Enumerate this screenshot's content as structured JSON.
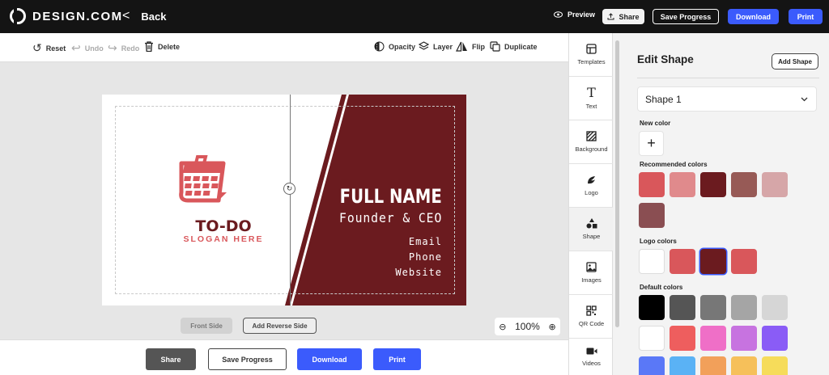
{
  "topbar": {
    "brand": "DESIGN.COM",
    "back_label": "Back",
    "preview_label": "Preview",
    "share_label": "Share",
    "save_label": "Save Progress",
    "download_label": "Download",
    "print_label": "Print"
  },
  "toolbar": {
    "reset": "Reset",
    "undo": "Undo",
    "redo": "Redo",
    "delete": "Delete",
    "opacity": "Opacity",
    "layer": "Layer",
    "flip": "Flip",
    "duplicate": "Duplicate"
  },
  "card": {
    "logo_title": "TO-DO",
    "slogan": "SLOGAN HERE",
    "full_name": "FULL NAME",
    "role": "Founder & CEO",
    "email": "Email",
    "phone": "Phone",
    "website": "Website",
    "colors": {
      "dark_red": "#6b1b1f",
      "logo_red": "#d9575b"
    }
  },
  "canvas": {
    "front_side": "Front Side",
    "add_reverse": "Add Reverse Side",
    "zoom": "100%"
  },
  "bottombar": {
    "share": "Share",
    "save": "Save Progress",
    "download": "Download",
    "print": "Print"
  },
  "sidenav": {
    "items": [
      {
        "label": "Templates",
        "icon": "templates-icon"
      },
      {
        "label": "Text",
        "icon": "text-icon"
      },
      {
        "label": "Background",
        "icon": "background-icon"
      },
      {
        "label": "Logo",
        "icon": "logo-icon"
      },
      {
        "label": "Shape",
        "icon": "shape-icon"
      },
      {
        "label": "Images",
        "icon": "images-icon"
      },
      {
        "label": "QR Code",
        "icon": "qr-code-icon"
      },
      {
        "label": "Videos",
        "icon": "videos-icon"
      }
    ]
  },
  "panel": {
    "title": "Edit Shape",
    "add_shape": "Add Shape",
    "selected_shape": "Shape 1",
    "new_color_label": "New color",
    "recommended_label": "Recommended colors",
    "logo_colors_label": "Logo colors",
    "default_colors_label": "Default colors",
    "recommended_colors": [
      "#d9575b",
      "#e08a8c",
      "#6b1b1f",
      "#975a56",
      "#d6a6a8",
      "#8a4e52"
    ],
    "logo_colors": [
      "#ffffff",
      "#d9575b",
      "#6b1b1f",
      "#d9575b"
    ],
    "selected_logo_color": "#6b1b1f",
    "default_colors": [
      "#000000",
      "#555555",
      "#777777",
      "#a5a5a5",
      "#d6d6d6",
      "#ffffff",
      "#ee5e5e",
      "#ef6fc7",
      "#c773e0",
      "#8a5cf6",
      "#5a78f7",
      "#5ab2f5",
      "#f2a05a",
      "#f6c05a",
      "#f6dc5a"
    ]
  },
  "accent_color": "#3b5bfc"
}
